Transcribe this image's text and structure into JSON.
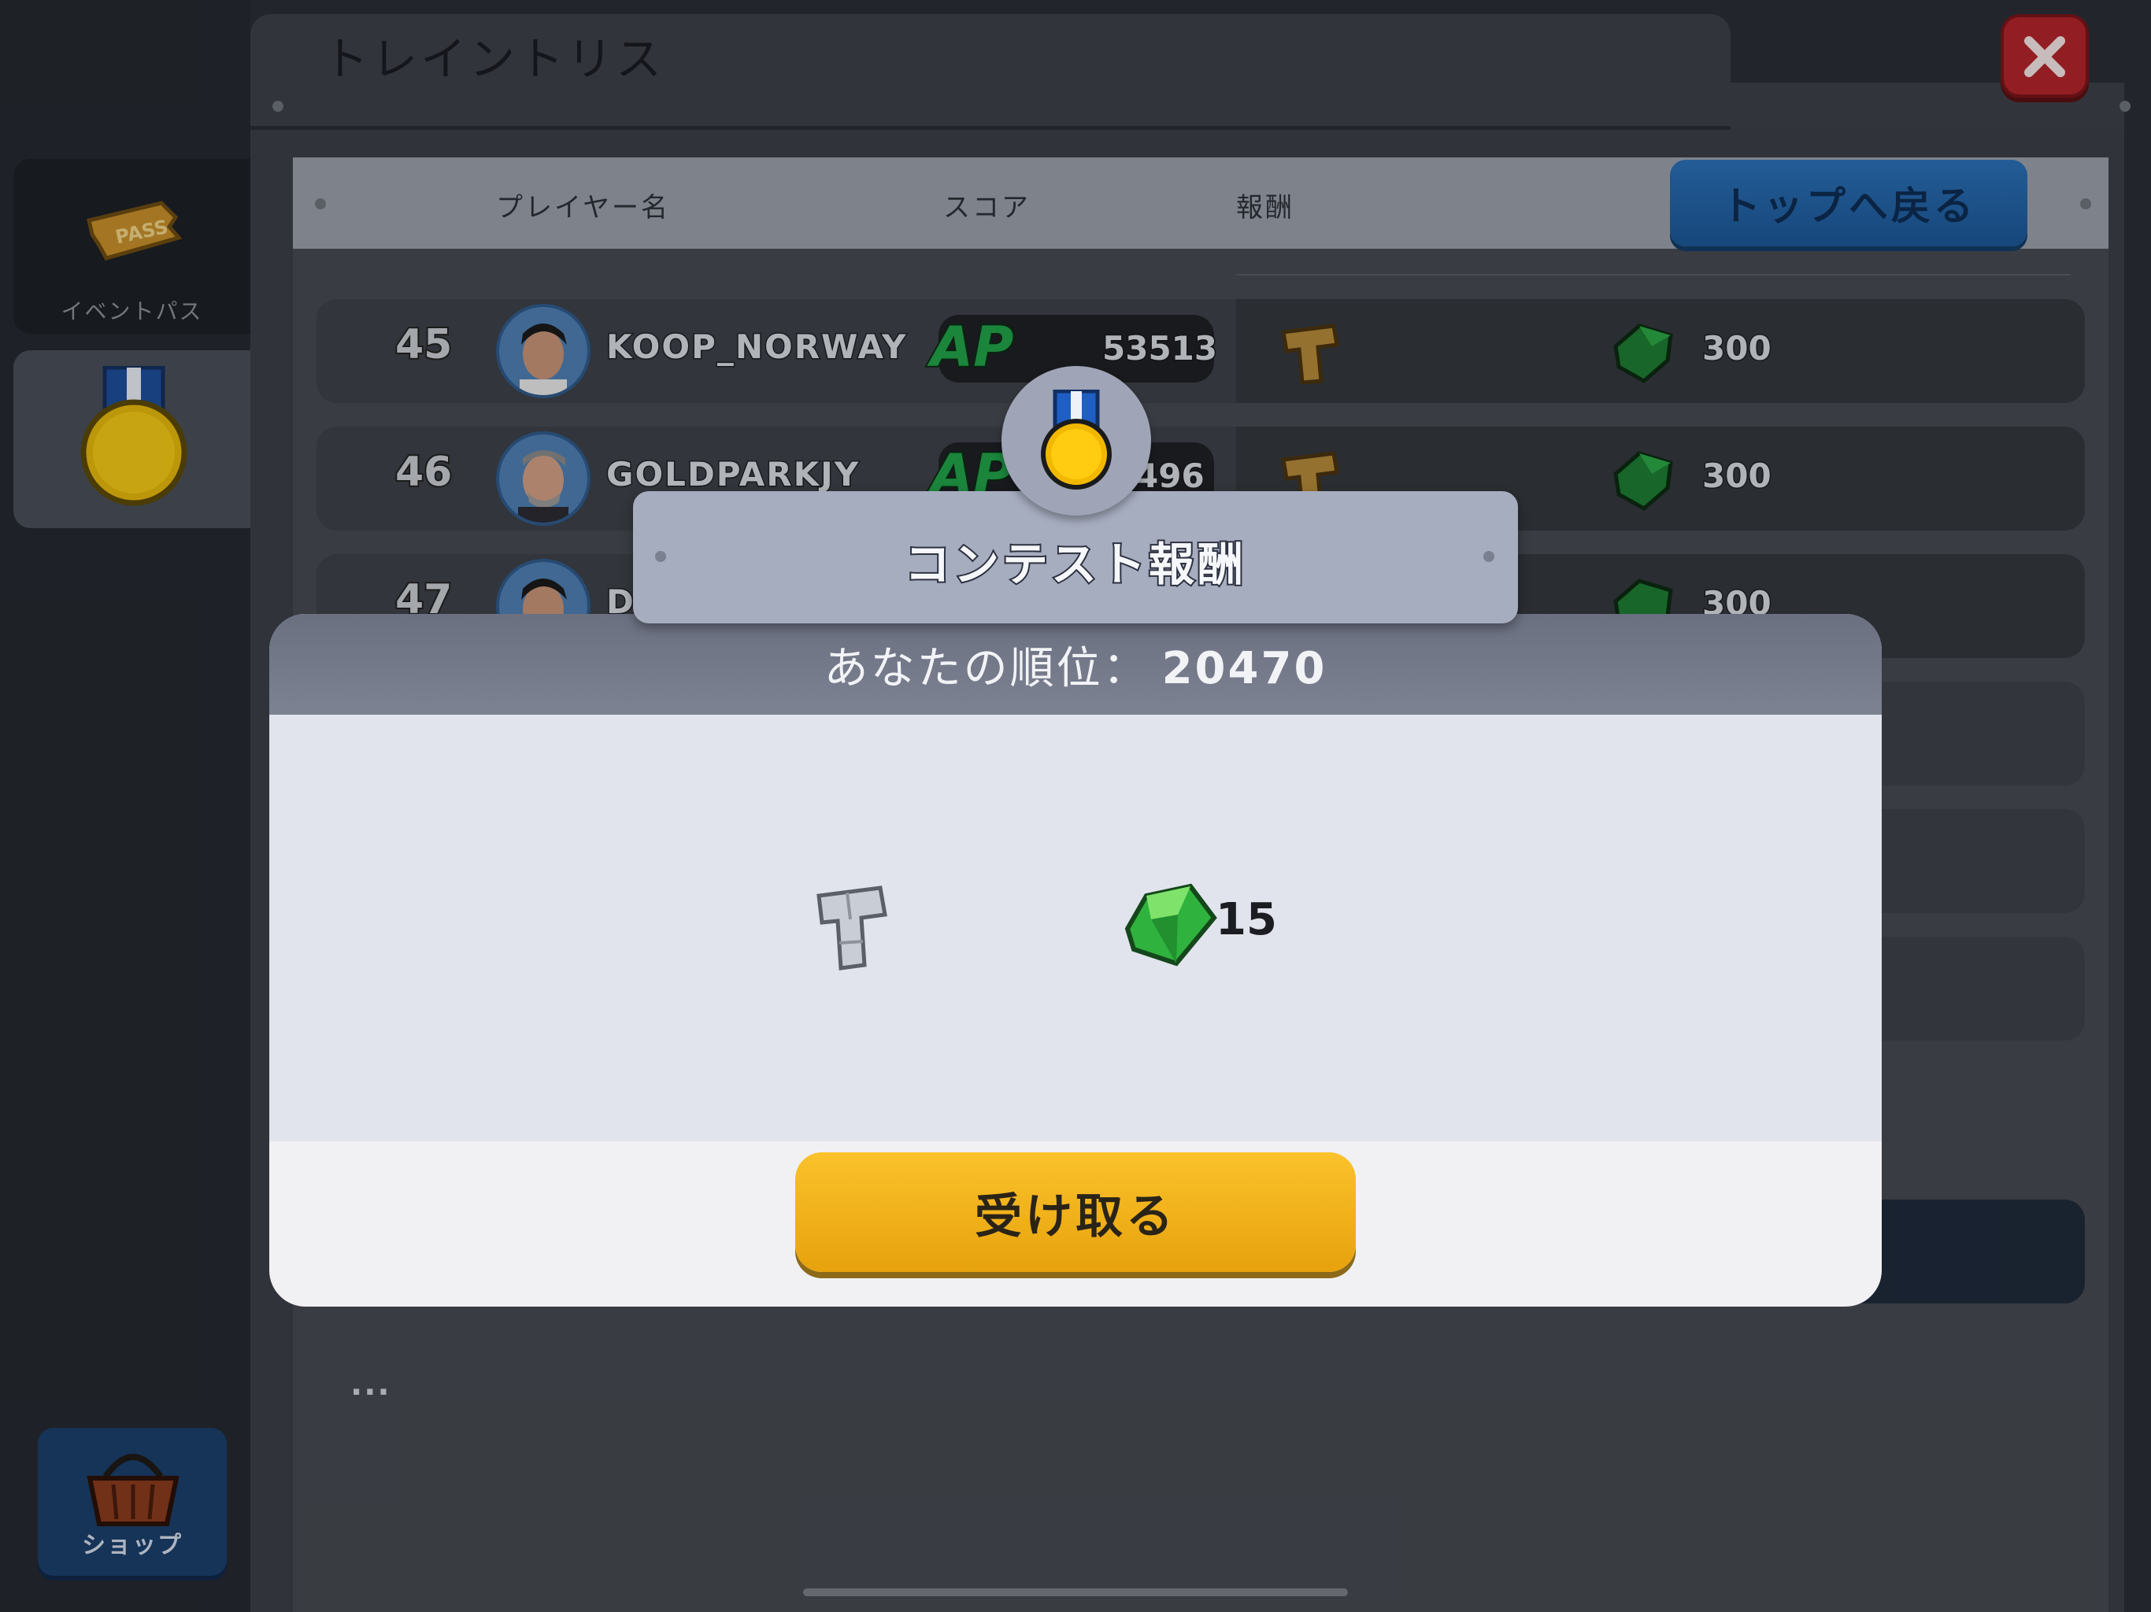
{
  "window": {
    "title": "トレイントリス"
  },
  "sidebar": {
    "event_pass_label": "イベントパス",
    "pass_ticket_text": "PASS",
    "shop_label": "ショップ"
  },
  "header": {
    "col_player": "プレイヤー名",
    "col_score": "スコア",
    "col_reward": "報酬",
    "back_button": "トップへ戻る"
  },
  "rows": [
    {
      "rank": "45",
      "name": "KOOP_NORWAY",
      "score_badge": "AP",
      "score": "53513",
      "gems": "300"
    },
    {
      "rank": "46",
      "name": "GOLDPARKJY",
      "score_badge": "AP",
      "score": "496",
      "gems": "300"
    },
    {
      "rank": "47",
      "name": "D",
      "gems": "300"
    }
  ],
  "more_indicator": "...",
  "modal": {
    "banner_title": "コンテスト報酬",
    "rank_label": "あなたの順位：",
    "rank_value": "20470",
    "gem_reward": "15",
    "claim_button": "受け取る"
  },
  "colors": {
    "close_button": "#b3252b",
    "back_button": "#1c5796",
    "claim_button": "#f2b21b",
    "gem": "#2fb23e"
  },
  "icons": [
    "pass-ticket-icon",
    "medal-icon",
    "shop-basket-icon",
    "close-icon",
    "tetromino-icon",
    "gem-icon"
  ]
}
